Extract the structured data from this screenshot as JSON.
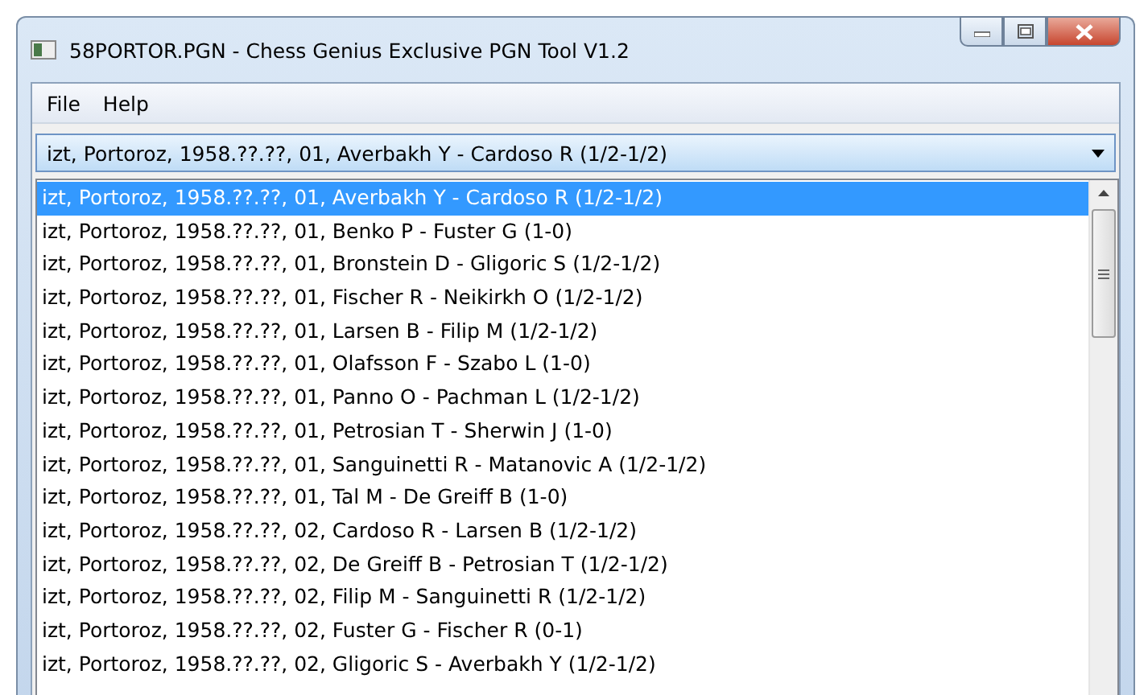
{
  "window": {
    "title": "58PORTOR.PGN - Chess Genius Exclusive PGN Tool V1.2"
  },
  "menu": [
    "File",
    "Help"
  ],
  "combo": {
    "value": "izt, Portoroz, 1958.??.??, 01, Averbakh Y - Cardoso R (1/2-1/2)"
  },
  "games": [
    {
      "text": "izt, Portoroz, 1958.??.??, 01, Averbakh Y - Cardoso R (1/2-1/2)",
      "selected": true
    },
    {
      "text": "izt, Portoroz, 1958.??.??, 01, Benko P - Fuster G (1-0)",
      "selected": false
    },
    {
      "text": "izt, Portoroz, 1958.??.??, 01, Bronstein D - Gligoric S (1/2-1/2)",
      "selected": false
    },
    {
      "text": "izt, Portoroz, 1958.??.??, 01, Fischer R - Neikirkh O (1/2-1/2)",
      "selected": false
    },
    {
      "text": "izt, Portoroz, 1958.??.??, 01, Larsen B - Filip M (1/2-1/2)",
      "selected": false
    },
    {
      "text": "izt, Portoroz, 1958.??.??, 01, Olafsson F - Szabo L (1-0)",
      "selected": false
    },
    {
      "text": "izt, Portoroz, 1958.??.??, 01, Panno O - Pachman L (1/2-1/2)",
      "selected": false
    },
    {
      "text": "izt, Portoroz, 1958.??.??, 01, Petrosian T - Sherwin J (1-0)",
      "selected": false
    },
    {
      "text": "izt, Portoroz, 1958.??.??, 01, Sanguinetti R - Matanovic A (1/2-1/2)",
      "selected": false
    },
    {
      "text": "izt, Portoroz, 1958.??.??, 01, Tal M - De Greiff B (1-0)",
      "selected": false
    },
    {
      "text": "izt, Portoroz, 1958.??.??, 02, Cardoso R - Larsen B (1/2-1/2)",
      "selected": false
    },
    {
      "text": "izt, Portoroz, 1958.??.??, 02, De Greiff B - Petrosian T (1/2-1/2)",
      "selected": false
    },
    {
      "text": "izt, Portoroz, 1958.??.??, 02, Filip M - Sanguinetti R (1/2-1/2)",
      "selected": false
    },
    {
      "text": "izt, Portoroz, 1958.??.??, 02, Fuster G - Fischer R (0-1)",
      "selected": false
    },
    {
      "text": "izt, Portoroz, 1958.??.??, 02, Gligoric S - Averbakh Y (1/2-1/2)",
      "selected": false
    }
  ]
}
